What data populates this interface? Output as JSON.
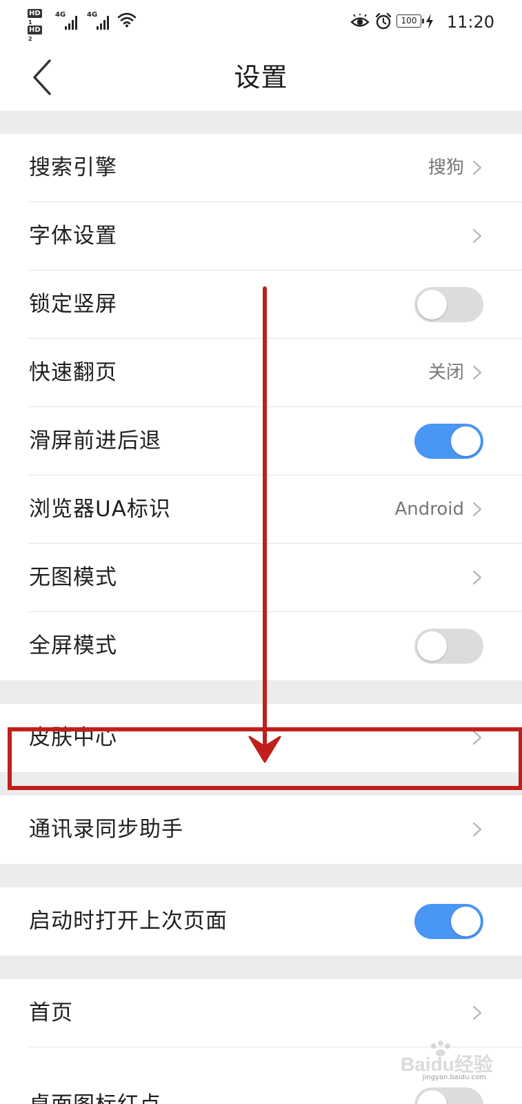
{
  "status_bar": {
    "hd1_label": "HD",
    "hd1_sub": "1",
    "hd2_label": "HD",
    "hd2_sub": "2",
    "net1_label": "4G",
    "net2_label": "4G",
    "battery_level": "100",
    "time": "11:20",
    "icons": [
      "signal-icon",
      "wifi-icon",
      "eye-icon",
      "alarm-icon",
      "battery-icon",
      "charging-bolt-icon"
    ]
  },
  "app_bar": {
    "title": "设置",
    "back_icon": "chevron-left-icon"
  },
  "settings": {
    "search_engine": {
      "label": "搜索引擎",
      "value": "搜狗"
    },
    "font_settings": {
      "label": "字体设置"
    },
    "lock_portrait": {
      "label": "锁定竖屏",
      "toggle_on": false
    },
    "fast_page_turn": {
      "label": "快速翻页",
      "value": "关闭"
    },
    "swipe_nav": {
      "label": "滑屏前进后退",
      "toggle_on": true
    },
    "ua_id": {
      "label": "浏览器UA标识",
      "value": "Android"
    },
    "no_image_mode": {
      "label": "无图模式"
    },
    "fullscreen_mode": {
      "label": "全屏模式",
      "toggle_on": false
    },
    "skin_center": {
      "label": "皮肤中心"
    },
    "contacts_sync": {
      "label": "通讯录同步助手"
    },
    "open_last_page": {
      "label": "启动时打开上次页面",
      "toggle_on": true
    },
    "home_page": {
      "label": "首页"
    },
    "desktop_badge": {
      "label": "桌面图标红点",
      "toggle_on": false
    }
  },
  "colors": {
    "toggle_on": "#4a96f5",
    "toggle_off": "#dcdcdc",
    "annotation_red": "#c0201c",
    "group_gap": "#ececec"
  },
  "watermark": {
    "text": "Baidu经验",
    "sub": "jingyan.baidu.com"
  }
}
